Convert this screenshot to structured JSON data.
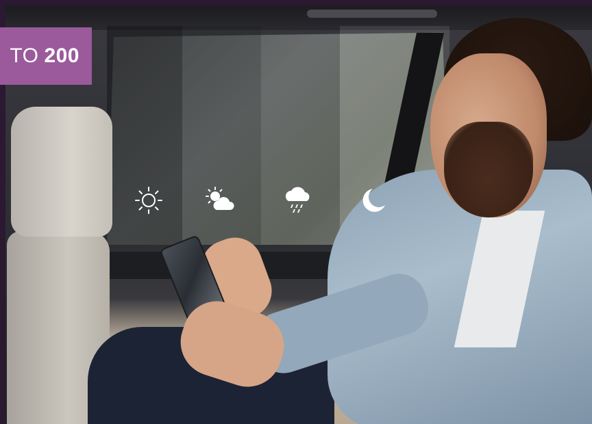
{
  "banner": {
    "lead_text": "TO",
    "number": "200",
    "background_color": "#9a5a9c"
  },
  "weather_icons": [
    {
      "name": "sun-icon"
    },
    {
      "name": "cloud-sun-icon"
    },
    {
      "name": "rain-cloud-icon"
    },
    {
      "name": "moon-icon"
    }
  ],
  "colors": {
    "frame": "#2a1930",
    "icon": "#ffffff"
  }
}
